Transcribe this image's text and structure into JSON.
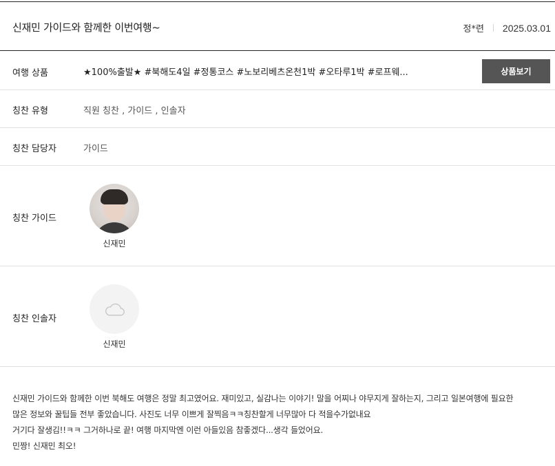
{
  "review": {
    "title": "신재민 가이드와 함께한 이번여행~",
    "author": "정*련",
    "date": "2025.03.01"
  },
  "product": {
    "label": "여행 상품",
    "name": "★100%출발★ #북해도4일 #정통코스 #노보리베츠온천1박 #오타루1박 #로프웨...",
    "button_label": "상품보기"
  },
  "praise_type": {
    "label": "칭찬 유형",
    "value": "직원 칭찬 , 가이드 , 인솔자"
  },
  "praise_staff": {
    "label": "칭찬 담당자",
    "value": "가이드"
  },
  "praise_guide": {
    "label": "칭찬 가이드",
    "name": "신재민"
  },
  "praise_leader": {
    "label": "칭찬 인솔자",
    "name": "신재민"
  },
  "body": {
    "lines": [
      "신재민 가이드와 함께한 이번 북해도 여행은 정말 최고였어요. 재미있고, 실감나는 이야기! 말을 어찌나 야무지게 잘하는지, 그리고 일본여행에 필요한",
      "많은 정보와 꿀팁들 전부 좋았습니다. 사진도 너무 이쁘게 잘찍음ㅋㅋ칭찬할게 너무많아 다 적을수가없내요",
      "거기다 잘생김!!ㅋㅋ 그거하나로 끝! 여행 마지막엔 이런 아들있음 참좋겠다...생각 들었어요.",
      "민짱! 신재민 최오!"
    ]
  },
  "icons": {
    "empty_avatar": "cloud-icon"
  },
  "colors": {
    "button_bg": "#555555",
    "border_dark": "#222222",
    "border_light": "#e1e1e1"
  }
}
